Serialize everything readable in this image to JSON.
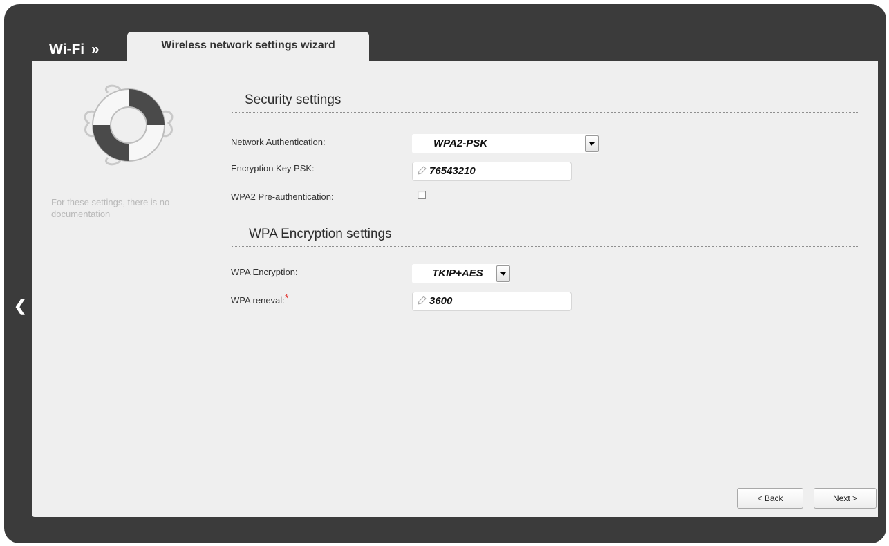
{
  "header": {
    "section": "Wi-Fi",
    "separator": "»",
    "tab_label": "Wireless network settings wizard"
  },
  "help": {
    "icon": "lifebuoy-icon",
    "text": "For these settings, there is no documentation"
  },
  "nav": {
    "back_arrow_icon": "chevron-left-icon"
  },
  "security": {
    "title": "Security settings",
    "auth_label": "Network Authentication:",
    "auth_value": "WPA2-PSK",
    "psk_label": "Encryption Key PSK:",
    "psk_value": "76543210",
    "preauth_label": "WPA2 Pre-authentication:",
    "preauth_checked": false
  },
  "wpa": {
    "title": "WPA Encryption settings",
    "encryption_label": "WPA Encryption:",
    "encryption_value": "TKIP+AES",
    "renewal_label": "WPA reneval:",
    "renewal_required_mark": "*",
    "renewal_value": "3600"
  },
  "buttons": {
    "back": "< Back",
    "next": "Next >"
  },
  "colors": {
    "frame": "#3b3b3b",
    "panel": "#efefef",
    "required": "#e0201b"
  }
}
